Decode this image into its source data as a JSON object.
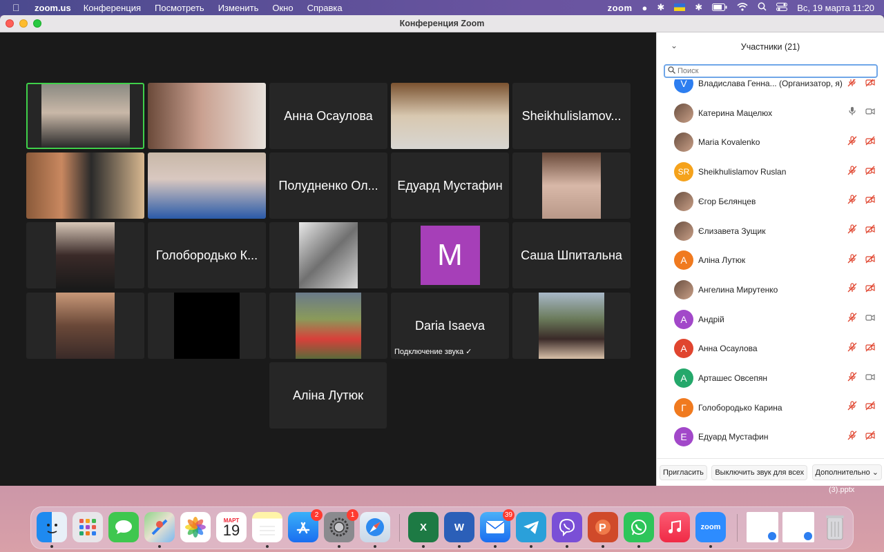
{
  "menubar": {
    "app": "zoom.us",
    "menus": [
      "Конференция",
      "Посмотреть",
      "Изменить",
      "Окно",
      "Справка"
    ],
    "zoom_label": "zoom",
    "datetime": "Вс, 19 марта  11:20"
  },
  "window": {
    "title": "Конференция Zoom"
  },
  "gallery": {
    "tiles": [
      {
        "type": "video",
        "label": ""
      },
      {
        "type": "video",
        "label": ""
      },
      {
        "type": "name",
        "label": "Анна Осаулова"
      },
      {
        "type": "video",
        "label": ""
      },
      {
        "type": "name",
        "label": "Sheikhulislamov..."
      },
      {
        "type": "video",
        "label": ""
      },
      {
        "type": "video",
        "label": ""
      },
      {
        "type": "name",
        "label": "Полудненко Ол..."
      },
      {
        "type": "name",
        "label": "Едуард Мустафин"
      },
      {
        "type": "video",
        "label": ""
      },
      {
        "type": "video",
        "label": ""
      },
      {
        "type": "name",
        "label": "Голобородько К..."
      },
      {
        "type": "video",
        "label": ""
      },
      {
        "type": "avatar",
        "label": "M"
      },
      {
        "type": "name",
        "label": "Саша Шпитальна"
      },
      {
        "type": "video",
        "label": ""
      },
      {
        "type": "video",
        "label": ""
      },
      {
        "type": "video",
        "label": ""
      },
      {
        "type": "name",
        "label": "Daria Isaeva",
        "note": "Подключение звука  ✓"
      },
      {
        "type": "video",
        "label": ""
      },
      {
        "type": "name",
        "label": "Аліна Лутюк"
      }
    ]
  },
  "panel": {
    "title": "Участники (21)",
    "search_placeholder": "Поиск",
    "participants": [
      {
        "name": "Владислава Генна...  (Организатор, я)",
        "initial": "V",
        "color": "#2d7ef0",
        "mic": "muted",
        "video": "off"
      },
      {
        "name": "Катерина Мацелюх",
        "initial": "",
        "color": "",
        "mic": "on",
        "video": "on"
      },
      {
        "name": "Maria Kovalenko",
        "initial": "",
        "color": "",
        "mic": "muted",
        "video": "off"
      },
      {
        "name": "Sheikhulislamov Ruslan",
        "initial": "SR",
        "color": "#f5a21b",
        "mic": "muted",
        "video": "off"
      },
      {
        "name": "Єгор Бєлянцев",
        "initial": "",
        "color": "",
        "mic": "muted",
        "video": "off"
      },
      {
        "name": "Єлизавета Зущик",
        "initial": "",
        "color": "",
        "mic": "muted",
        "video": "off"
      },
      {
        "name": "Аліна Лутюк",
        "initial": "А",
        "color": "#f07a1f",
        "mic": "muted",
        "video": "off"
      },
      {
        "name": "Ангелина Мирутенко",
        "initial": "",
        "color": "",
        "mic": "muted",
        "video": "off"
      },
      {
        "name": "Андрій",
        "initial": "А",
        "color": "#a248c9",
        "mic": "muted",
        "video": "on"
      },
      {
        "name": "Анна Осаулова",
        "initial": "А",
        "color": "#e0452f",
        "mic": "muted",
        "video": "off"
      },
      {
        "name": "Арташес Овсепян",
        "initial": "А",
        "color": "#25a86b",
        "mic": "muted",
        "video": "on"
      },
      {
        "name": "Голобородько Карина",
        "initial": "Г",
        "color": "#f07a1f",
        "mic": "muted",
        "video": "off"
      },
      {
        "name": "Едуард Мустафин",
        "initial": "Е",
        "color": "#a248c9",
        "mic": "muted",
        "video": "off"
      }
    ],
    "footer": {
      "invite": "Пригласить",
      "mute_all": "Выключить звук для всех",
      "more": "Дополнительно"
    }
  },
  "desktop": {
    "file_label": "(3).pptx"
  },
  "dock": {
    "calendar_month": "МАРТ",
    "calendar_day": "19",
    "appstore_badge": "2",
    "settings_badge": "1",
    "mail_badge": "39",
    "excel": "X",
    "word": "W",
    "zoom": "zoom"
  }
}
